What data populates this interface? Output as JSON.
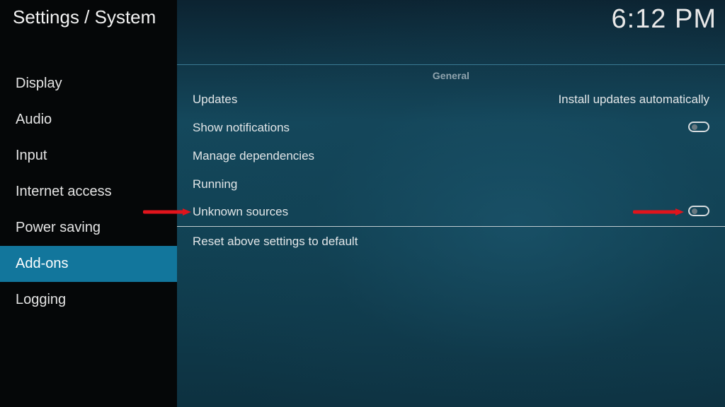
{
  "header": {
    "title": "Settings / System",
    "clock": "6:12 PM"
  },
  "sidebar": {
    "items": [
      {
        "label": "Display"
      },
      {
        "label": "Audio"
      },
      {
        "label": "Input"
      },
      {
        "label": "Internet access"
      },
      {
        "label": "Power saving"
      },
      {
        "label": "Add-ons",
        "active": true
      },
      {
        "label": "Logging"
      }
    ]
  },
  "main": {
    "group_label": "General",
    "settings": [
      {
        "label": "Updates",
        "value": "Install updates automatically"
      },
      {
        "label": "Show notifications",
        "toggle": false
      },
      {
        "label": "Manage dependencies"
      },
      {
        "label": "Running"
      },
      {
        "label": "Unknown sources",
        "toggle": false,
        "highlighted_by_arrows": true
      }
    ],
    "reset_label": "Reset above settings to default"
  },
  "colors": {
    "accent_selected": "#12769c",
    "sidebar_bg": "#050708",
    "annotation_arrow": "#e0141c"
  },
  "icons": [
    "red-arrow-annotation"
  ]
}
